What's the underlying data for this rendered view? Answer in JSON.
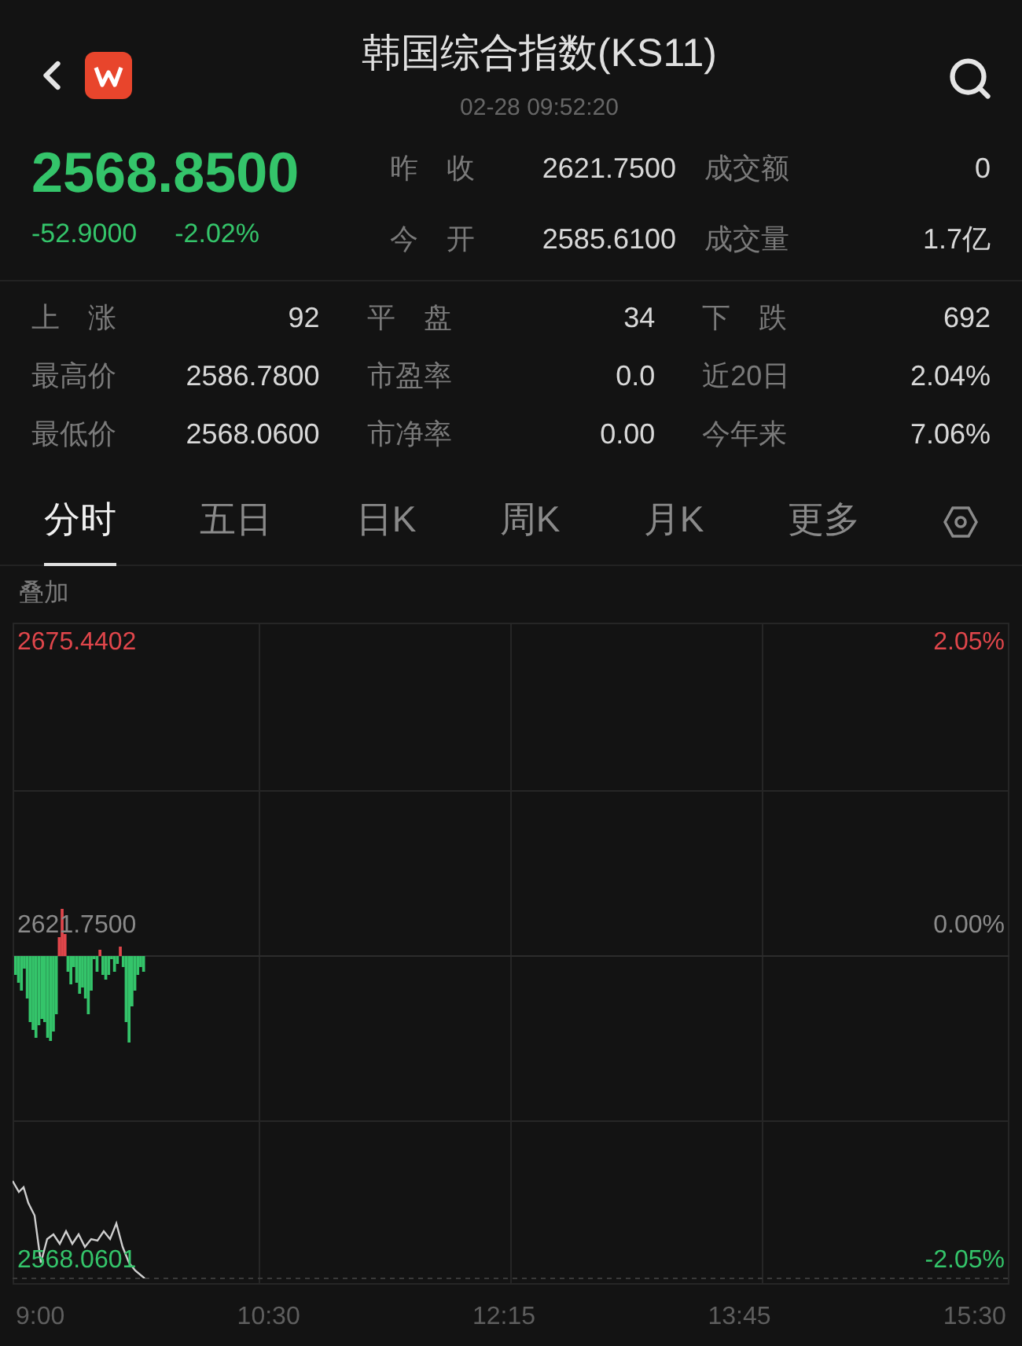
{
  "header": {
    "title": "韩国综合指数(KS11)",
    "time": "02-28 09:52:20"
  },
  "quote": {
    "price": "2568.8500",
    "change": "-52.9000",
    "change_pct": "-2.02%",
    "falling": true
  },
  "quote_stats": [
    {
      "label": "昨收",
      "value": "2621.7500"
    },
    {
      "label": "成交额",
      "value": "0"
    },
    {
      "label": "今开",
      "value": "2585.6100"
    },
    {
      "label": "成交量",
      "value": "1.7亿"
    }
  ],
  "stats": [
    {
      "label": "上 涨",
      "value": "92"
    },
    {
      "label": "平 盘",
      "value": "34"
    },
    {
      "label": "下 跌",
      "value": "692"
    },
    {
      "label": "最高价",
      "value": "2586.7800"
    },
    {
      "label": "市盈率",
      "value": "0.0"
    },
    {
      "label": "近20日",
      "value": "2.04%"
    },
    {
      "label": "最低价",
      "value": "2568.0600"
    },
    {
      "label": "市净率",
      "value": "0.00"
    },
    {
      "label": "今年来",
      "value": "7.06%"
    }
  ],
  "tabs": [
    {
      "label": "分时",
      "selected": true
    },
    {
      "label": "五日",
      "selected": false
    },
    {
      "label": "日K",
      "selected": false
    },
    {
      "label": "周K",
      "selected": false
    },
    {
      "label": "月K",
      "selected": false
    },
    {
      "label": "更多",
      "selected": false
    }
  ],
  "chart": {
    "overlay": "叠加",
    "top_price": "2675.4402",
    "top_pct": "2.05%",
    "mid_price": "2621.7500",
    "mid_pct": "0.00%",
    "low_price": "2568.0601",
    "low_pct": "-2.05%",
    "times": [
      "9:00",
      "10:30",
      "12:15",
      "13:45",
      "15:30"
    ]
  }
}
